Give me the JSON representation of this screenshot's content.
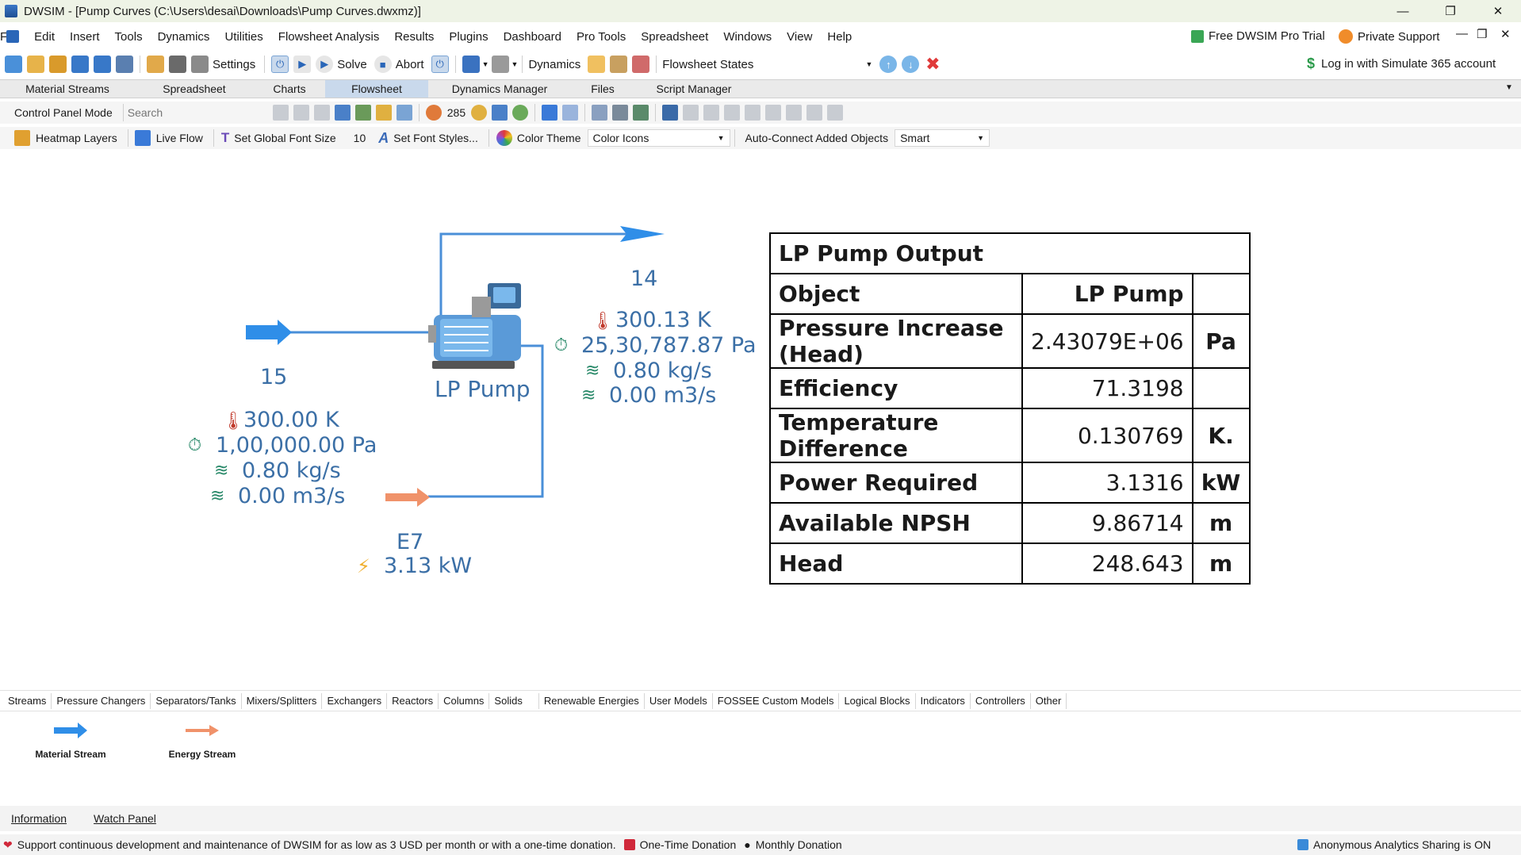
{
  "window": {
    "title": "DWSIM - [Pump Curves (C:\\Users\\desai\\Downloads\\Pump Curves.dwxmz)]"
  },
  "menu": [
    "File",
    "Edit",
    "Insert",
    "Tools",
    "Dynamics",
    "Utilities",
    "Flowsheet Analysis",
    "Results",
    "Plugins",
    "Dashboard",
    "Pro Tools",
    "Spreadsheet",
    "Windows",
    "View",
    "Help"
  ],
  "menu_right": {
    "pro_trial": "Free DWSIM Pro Trial",
    "support": "Private Support"
  },
  "toolbar": {
    "settings": "Settings",
    "solve": "Solve",
    "abort": "Abort",
    "dynamics": "Dynamics",
    "flowsheet_states": "Flowsheet States",
    "login": "Log in with Simulate 365 account"
  },
  "tabs": [
    "Material Streams",
    "Spreadsheet",
    "Charts",
    "Flowsheet",
    "Dynamics Manager",
    "Files",
    "Script Manager"
  ],
  "active_tab": "Flowsheet",
  "flowsheet_toolbar": {
    "control_panel_mode": "Control Panel Mode",
    "search_placeholder": "Search",
    "zoom": "285",
    "heatmap_layers": "Heatmap Layers",
    "live_flow": "Live Flow",
    "set_global_font_size": "Set Global Font Size",
    "font_size_value": "10",
    "set_font_styles": "Set Font Styles...",
    "color_theme": "Color Theme",
    "color_theme_value": "Color Icons",
    "auto_connect": "Auto-Connect Added Objects",
    "auto_connect_value": "Smart"
  },
  "flowsheet": {
    "stream_15": {
      "name": "15",
      "temperature": "300.00 K",
      "pressure": "1,00,000.00 Pa",
      "mass_flow": "0.80 kg/s",
      "vol_flow": "0.00 m3/s"
    },
    "stream_14": {
      "name": "14",
      "temperature": "300.13 K",
      "pressure": "25,30,787.87 Pa",
      "mass_flow": "0.80 kg/s",
      "vol_flow": "0.00 m3/s"
    },
    "pump": {
      "name": "LP Pump"
    },
    "energy": {
      "name": "E7",
      "power": "3.13 kW"
    }
  },
  "output_table": {
    "title": "LP Pump Output",
    "header": {
      "object": "Object",
      "value": "LP Pump",
      "unit": ""
    },
    "rows": [
      {
        "name": "Pressure Increase (Head)",
        "value": "2.43079E+06",
        "unit": "Pa"
      },
      {
        "name": "Efficiency",
        "value": "71.3198",
        "unit": ""
      },
      {
        "name": "Temperature Difference",
        "value": "0.130769",
        "unit": "K."
      },
      {
        "name": "Power Required",
        "value": "3.1316",
        "unit": "kW"
      },
      {
        "name": "Available NPSH",
        "value": "9.86714",
        "unit": "m"
      },
      {
        "name": "Head",
        "value": "248.643",
        "unit": "m"
      }
    ]
  },
  "palette_tabs": [
    "Streams",
    "Pressure Changers",
    "Separators/Tanks",
    "Mixers/Splitters",
    "Exchangers",
    "Reactors",
    "Columns",
    "Solids",
    "Renewable Energies",
    "User Models",
    "FOSSEE Custom Models",
    "Logical Blocks",
    "Indicators",
    "Controllers",
    "Other"
  ],
  "palette_items": {
    "material": "Material Stream",
    "energy": "Energy Stream"
  },
  "bottom_tabs": {
    "information": "Information",
    "watch": "Watch Panel"
  },
  "status": {
    "support_text": "Support continuous development and maintenance of DWSIM for as low as 3 USD per month or with a one-time donation.",
    "one_time": "One-Time Donation",
    "monthly": "Monthly Donation",
    "analytics": "Anonymous Analytics Sharing is ON"
  },
  "colors": {
    "stream_blue": "#2f8ee8",
    "energy_orange": "#f0926a",
    "label_blue": "#3b6fa6",
    "active_tab": "#c9d9ec"
  }
}
